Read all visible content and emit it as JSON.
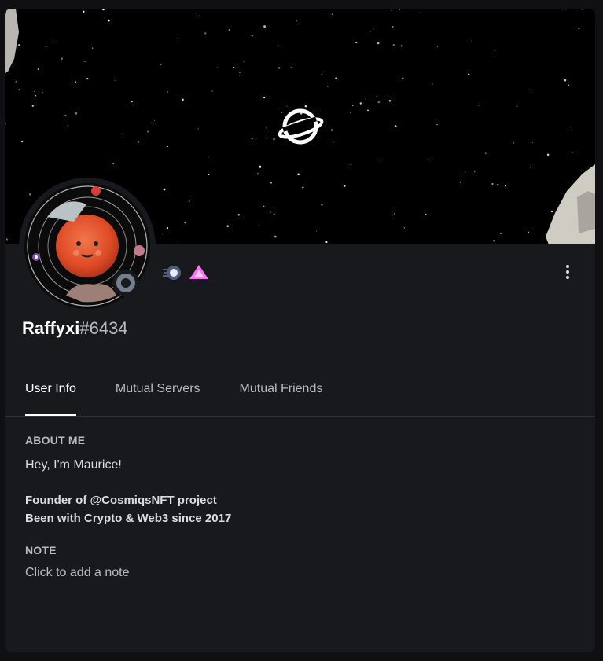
{
  "profile": {
    "username": "Raffyxi",
    "discriminator": "#6434",
    "status": "offline"
  },
  "badges": [
    {
      "icon": "hypesquad-balance-icon"
    },
    {
      "icon": "nitro-boost-gem-icon"
    }
  ],
  "tabs": [
    {
      "label": "User Info",
      "active": true
    },
    {
      "label": "Mutual Servers",
      "active": false
    },
    {
      "label": "Mutual Friends",
      "active": false
    }
  ],
  "about": {
    "title": "ABOUT ME",
    "lines": [
      "Hey, I'm Maurice!",
      "Founder of @CosmiqsNFT project",
      "Been with Crypto & Web3 since 2017"
    ]
  },
  "note": {
    "title": "NOTE",
    "placeholder": "Click to add a note"
  },
  "colors": {
    "card_bg": "#18191c",
    "banner_bg": "#000000",
    "planet": "#e5532f",
    "status_offline": "#747f8d",
    "boost_badge": "#ff73fa"
  }
}
